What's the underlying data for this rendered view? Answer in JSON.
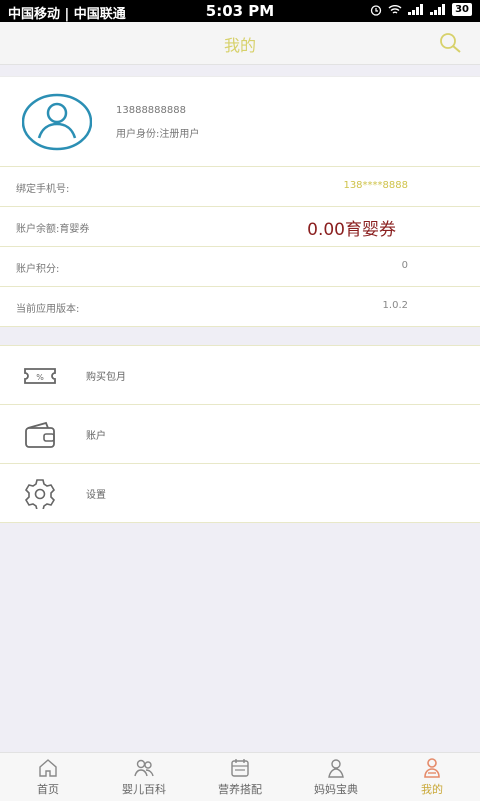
{
  "status_bar": {
    "carriers": "中国移动 | 中国联通",
    "time": "5:03 PM",
    "battery": "30"
  },
  "header": {
    "title": "我的"
  },
  "profile": {
    "phone": "13888888888",
    "identity": "用户身份:注册用户"
  },
  "info_rows": [
    {
      "label": "绑定手机号:",
      "value": "138****8888"
    },
    {
      "label": "账户余额:育婴券",
      "value": "0.00育婴券"
    },
    {
      "label": "账户积分:",
      "value": "0"
    },
    {
      "label": "当前应用版本:",
      "value": "1.0.2"
    }
  ],
  "menu": [
    {
      "label": "购买包月",
      "icon": "coupon-icon"
    },
    {
      "label": "账户",
      "icon": "wallet-icon"
    },
    {
      "label": "设置",
      "icon": "gear-icon"
    }
  ],
  "tabs": [
    {
      "label": "首页",
      "icon": "home-icon"
    },
    {
      "label": "婴儿百科",
      "icon": "people-icon"
    },
    {
      "label": "营养搭配",
      "icon": "calendar-icon"
    },
    {
      "label": "妈妈宝典",
      "icon": "user-icon"
    },
    {
      "label": "我的",
      "icon": "profile-icon",
      "active": true
    }
  ],
  "colors": {
    "accent": "#d7d16a",
    "active_tab": "#c9a838",
    "balance": "#8a1f1f",
    "avatar": "#2b8fb4"
  }
}
